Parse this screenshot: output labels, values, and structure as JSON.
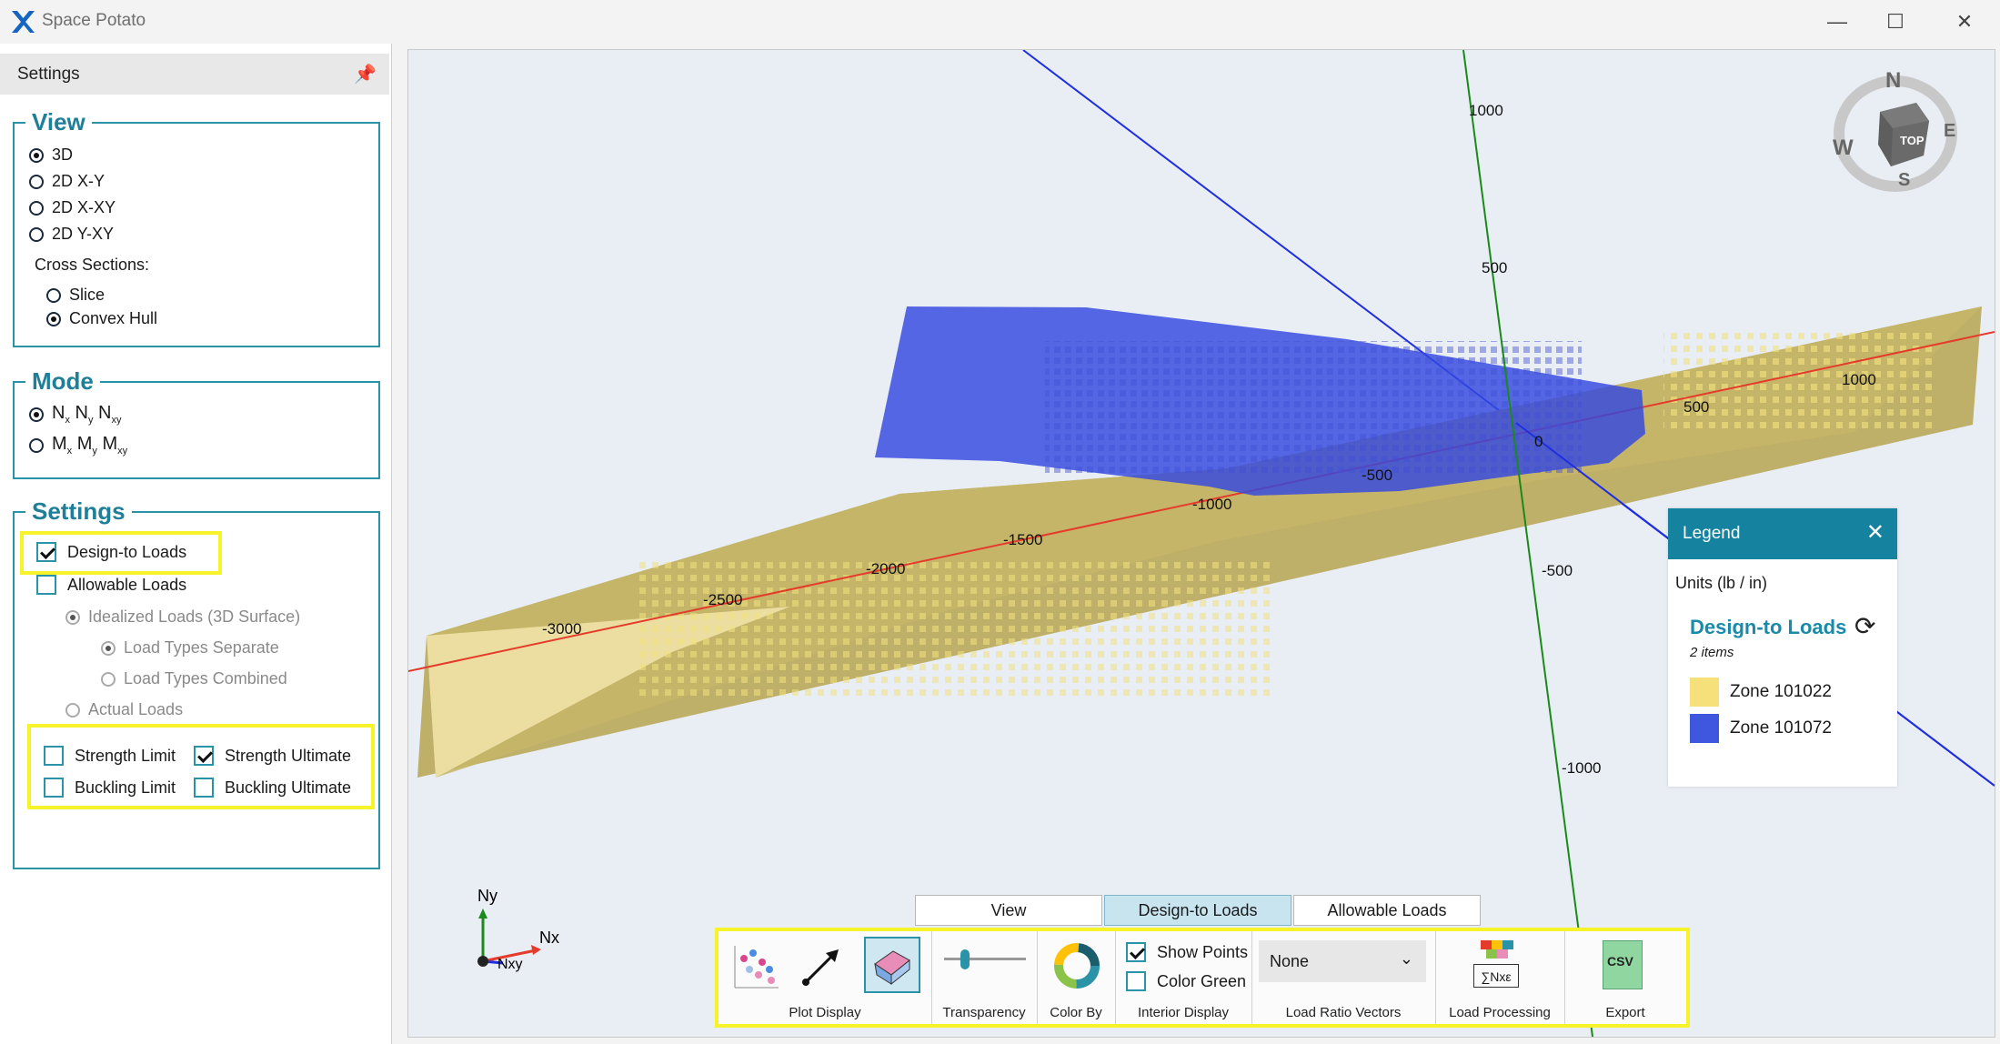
{
  "window": {
    "title": "Space Potato",
    "min_glyph": "—",
    "max_glyph": "☐",
    "close_glyph": "✕"
  },
  "settings_panel": {
    "title": "Settings",
    "view": {
      "legend": "View",
      "options": [
        "3D",
        "2D X-Y",
        "2D X-XY",
        "2D Y-XY"
      ],
      "selected": "3D",
      "cross_sections_label": "Cross Sections:",
      "cross_sections": [
        "Slice",
        "Convex Hull"
      ],
      "cross_selected": "Convex Hull"
    },
    "mode": {
      "legend": "Mode",
      "selected": "N"
    },
    "settings": {
      "legend": "Settings",
      "design_to_loads": {
        "label": "Design-to Loads",
        "checked": true
      },
      "allowable_loads": {
        "label": "Allowable Loads",
        "checked": false
      },
      "idealized_loads": "Idealized Loads (3D Surface)",
      "load_types_separate": "Load Types Separate",
      "load_types_combined": "Load Types Combined",
      "actual_loads": "Actual Loads",
      "strength_limit": {
        "label": "Strength Limit",
        "checked": false
      },
      "strength_ultimate": {
        "label": "Strength Ultimate",
        "checked": true
      },
      "buckling_limit": {
        "label": "Buckling Limit",
        "checked": false
      },
      "buckling_ultimate": {
        "label": "Buckling Ultimate",
        "checked": false
      }
    }
  },
  "plot": {
    "axis_labels": [
      "1000",
      "500",
      "-500",
      "-1000",
      "-1500",
      "-2000",
      "-2500",
      "-3000",
      "0",
      "1000",
      "500",
      "-500",
      "-1000"
    ],
    "triad": {
      "ny": "Ny",
      "nx": "Nx",
      "nxy": "Nxy"
    },
    "compass": {
      "n": "N",
      "s": "S",
      "e": "E",
      "w": "W",
      "top": "TOP"
    }
  },
  "legend": {
    "title": "Legend",
    "close": "✕",
    "units": "Units (lb / in)",
    "section_title": "Design-to Loads",
    "count": "2 items",
    "refresh_icon": "refresh-icon",
    "items": [
      {
        "label": "Zone 101022",
        "color": "#f5e07a"
      },
      {
        "label": "Zone 101072",
        "color": "#3f57de"
      }
    ]
  },
  "tabs": [
    "View",
    "Design-to Loads",
    "Allowable Loads"
  ],
  "active_tab": "Design-to Loads",
  "ribbon": {
    "plot_display": "Plot Display",
    "transparency": "Transparency",
    "transparency_level": 0.2,
    "color_by": "Color By",
    "show_points": {
      "label": "Show Points",
      "checked": true
    },
    "color_green": {
      "label": "Color Green",
      "checked": false
    },
    "interior_display": "Interior Display",
    "load_ratio_value": "None",
    "load_ratio_vectors": "Load Ratio Vectors",
    "load_processing": "Load Processing",
    "load_processing_icon_text": "∑Nxε",
    "export": "Export",
    "export_icon_text": "CSV"
  }
}
